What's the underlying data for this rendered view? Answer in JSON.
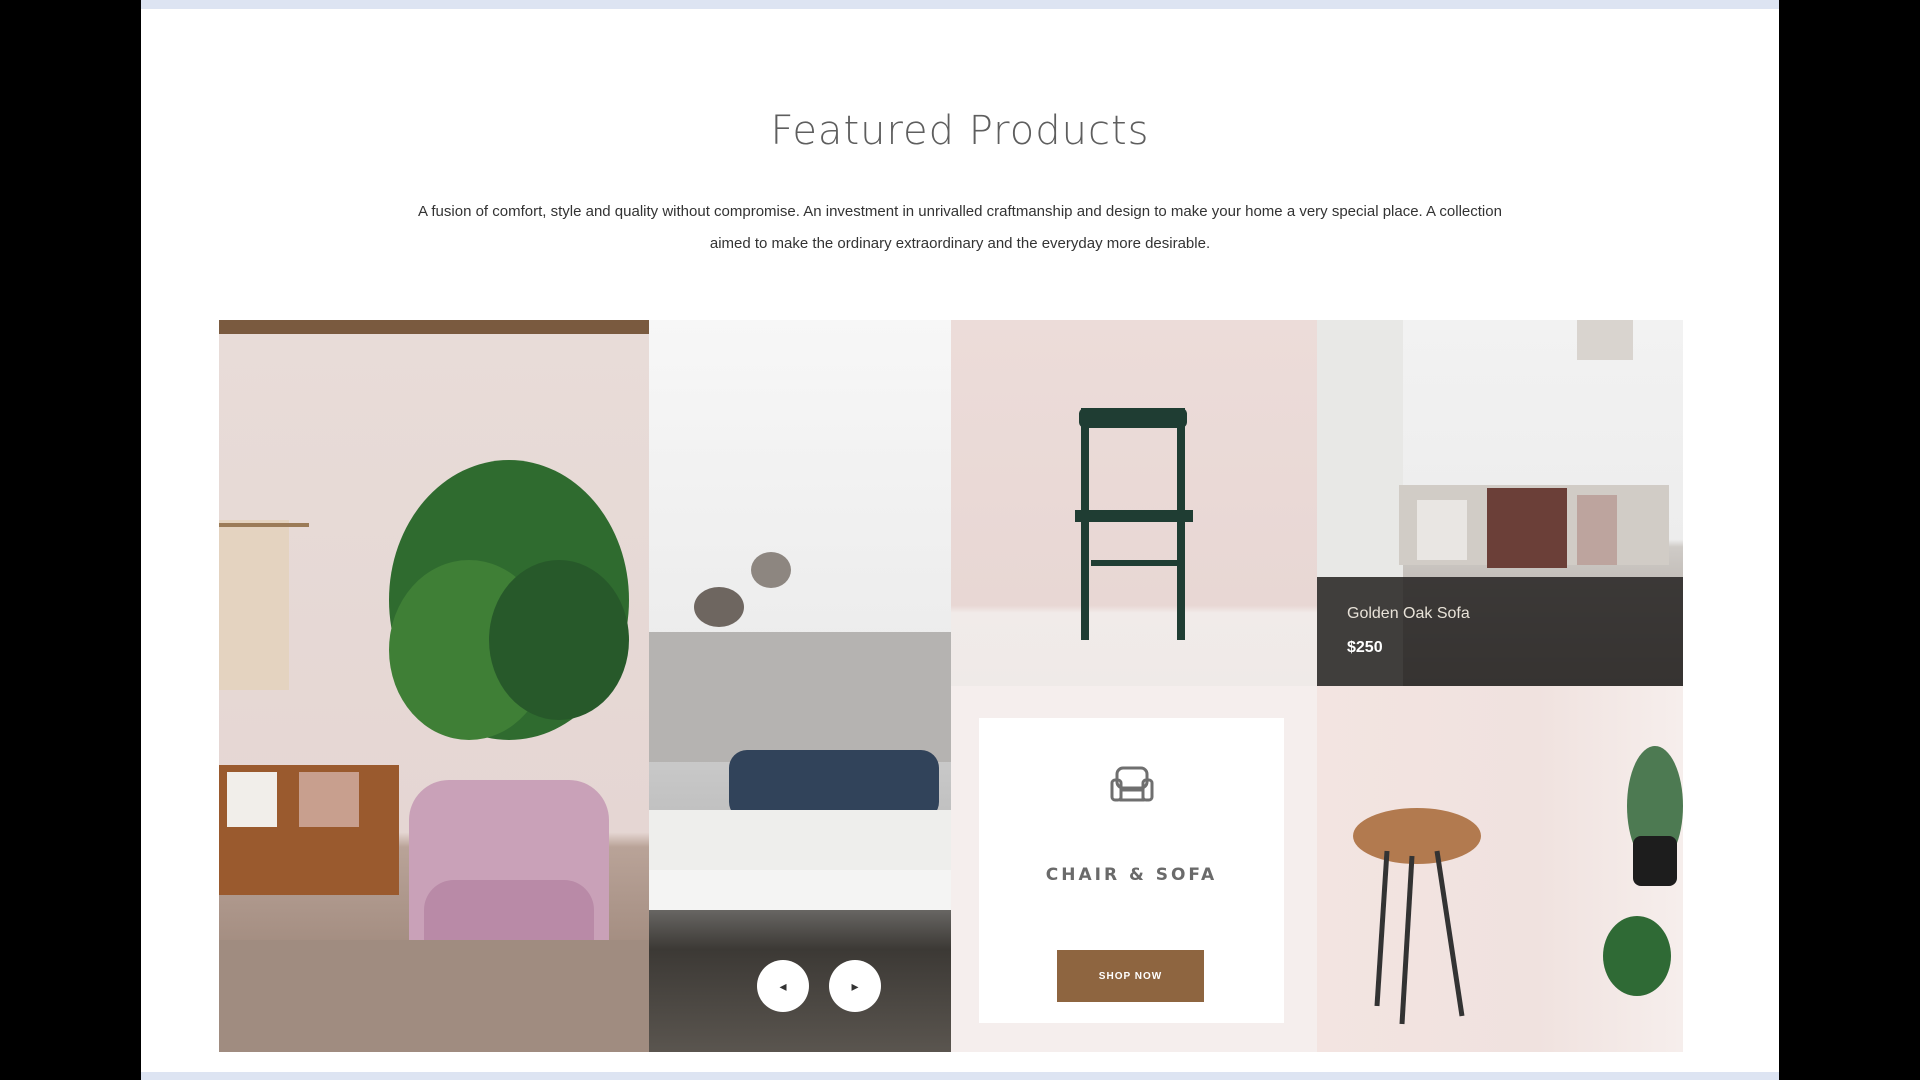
{
  "section": {
    "title": "Featured Products",
    "intro": "A fusion of comfort, style and quality without compromise. An investment in unrivalled craftmanship and design to make your home a very special place. A collection aimed to make the ordinary extraordinary and the everyday more desirable."
  },
  "category_card": {
    "icon": "armchair-icon",
    "title": "CHAIR & SOFA",
    "button_label": "SHOP NOW"
  },
  "product_overlay": {
    "name": "Golden Oak Sofa",
    "price": "$250"
  },
  "slider": {
    "prev_label": "◂",
    "next_label": "▸"
  },
  "colors": {
    "button_brown": "#8e6540",
    "overlay_dark": "#282624",
    "title_gray": "#5e5e5e"
  }
}
